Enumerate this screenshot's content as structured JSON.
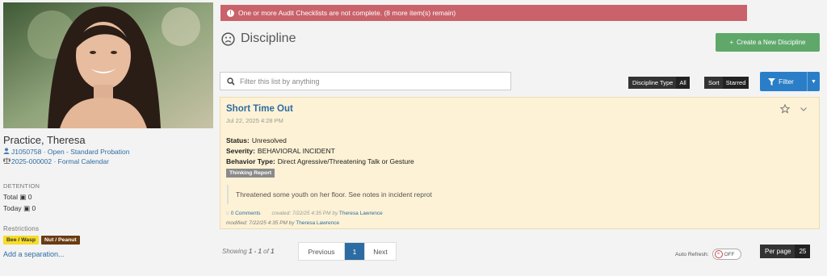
{
  "alert": {
    "text": "One or more Audit Checklists are not complete. (8 more item(s) remain)"
  },
  "header": {
    "title": "Discipline",
    "create_label": "Create a New Discipline"
  },
  "profile": {
    "name": "Practice, Theresa",
    "id_line": "J1050758 · Open - Standard Probation",
    "case_line": "2025-000002 · Formal Calendar",
    "detention_label": "DETENTION",
    "total_label": "Total",
    "total_value": "0",
    "today_label": "Today",
    "today_value": "0",
    "restrictions_label": "Restrictions",
    "badges": [
      "Bee / Wasp",
      "Nut / Peanut"
    ],
    "add_separation": "Add a separation..."
  },
  "filters": {
    "search_placeholder": "Filter this list by anything",
    "type_label": "Discipline Type",
    "type_value": "All",
    "sort_label": "Sort",
    "sort_value": "Starred",
    "filter_label": "Filter"
  },
  "card": {
    "title": "Short Time Out",
    "date": "Jul 22, 2025 4:28 PM",
    "status_label": "Status:",
    "status_value": "Unresolved",
    "severity_label": "Severity:",
    "severity_value": "BEHAVIORAL INCIDENT",
    "behavior_label": "Behavior Type:",
    "behavior_value": "Direct Agressive/Threatening Talk or Gesture",
    "tag": "Thinking Report",
    "note": "Threatened some youth on her floor.  See notes in incident reprot",
    "comments": "0 Comments",
    "created_prefix": "created: 7/22/25 4:35 PM by",
    "created_by": "Theresa Lawrence",
    "modified_prefix": "modified: 7/22/25 4:35 PM by",
    "modified_by": "Theresa Lawrence"
  },
  "pagination": {
    "showing_prefix": "Showing",
    "range": "1 - 1",
    "of_word": "of",
    "total": "1",
    "previous_label": "Previous",
    "current_page": "1",
    "next_label": "Next",
    "auto_refresh_label": "Auto Refresh:",
    "toggle_state": "OFF",
    "per_page_label": "Per page",
    "per_page_value": "25"
  },
  "colors": {
    "alert": "#c9626a",
    "create": "#5fa86a",
    "primary": "#2a7ec8",
    "card_bg": "#fdf2d5"
  },
  "icons": [
    "frown-face-icon",
    "plus-icon",
    "search-icon",
    "filter-funnel-icon",
    "star-icon",
    "chevron-down-icon",
    "user-icon",
    "scale-icon",
    "calendar-icon",
    "comment-icon"
  ]
}
